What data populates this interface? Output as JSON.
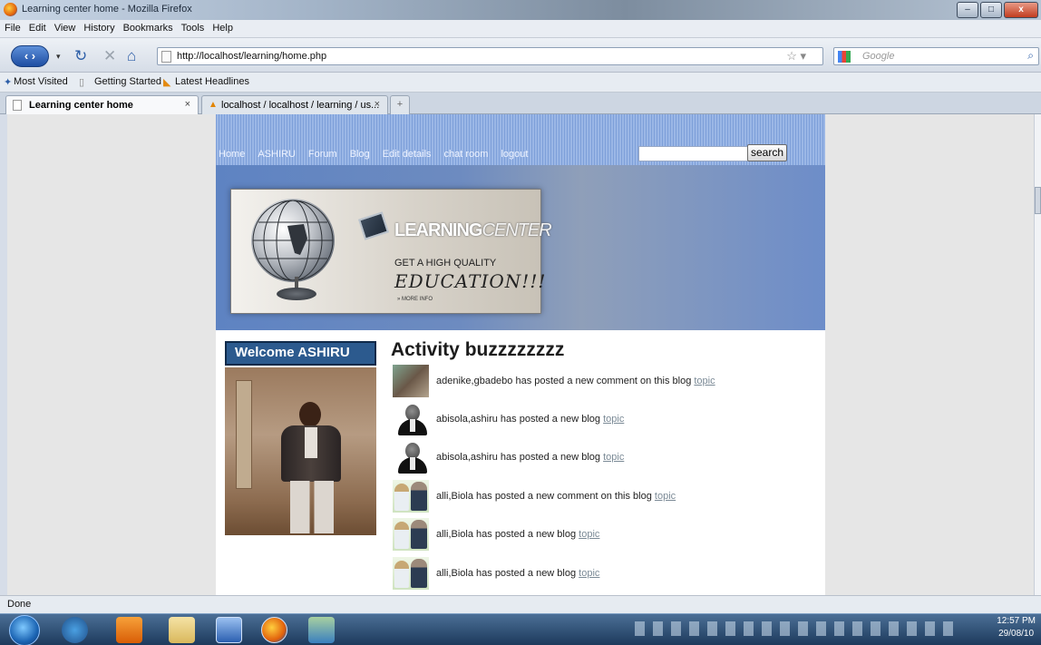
{
  "window": {
    "title": "Learning center home - Mozilla Firefox",
    "minimize": "–",
    "maximize": "□",
    "close": "x"
  },
  "menu": [
    "File",
    "Edit",
    "View",
    "History",
    "Bookmarks",
    "Tools",
    "Help"
  ],
  "nav": {
    "url": "http://localhost/learning/home.php",
    "search_engine_placeholder": "Google"
  },
  "bookmarks": [
    "Most Visited",
    "Getting Started",
    "Latest Headlines"
  ],
  "tabs": [
    {
      "label": "Learning center home",
      "active": true
    },
    {
      "label": "localhost / localhost / learning / us...",
      "active": false
    }
  ],
  "site": {
    "nav_links": [
      "Home",
      "ASHIRU",
      "Forum",
      "Blog",
      "Edit details",
      "chat room",
      "logout"
    ],
    "search_button": "search",
    "banner": {
      "brand": "LEARNING",
      "brand_script": "CENTER",
      "tagline": "GET A HIGH QUALITY",
      "tagline2": "EDUCATION!!!",
      "more": "» MORE INFO"
    },
    "welcome": "Welcome    ASHIRU",
    "activity_title": "Activity buzzzzzzzz",
    "activity": [
      {
        "text": "adenike,gbadebo has posted a new comment on this blog",
        "link": "topic",
        "avatar": "photo"
      },
      {
        "text": "abisola,ashiru has posted a new blog",
        "link": "topic",
        "avatar": "person"
      },
      {
        "text": "abisola,ashiru has posted a new blog",
        "link": "topic",
        "avatar": "person"
      },
      {
        "text": "alli,Biola has posted a new comment on this blog",
        "link": "topic",
        "avatar": "couple"
      },
      {
        "text": "alli,Biola has posted a new blog",
        "link": "topic",
        "avatar": "couple"
      },
      {
        "text": "alli,Biola has posted a new blog",
        "link": "topic",
        "avatar": "couple"
      }
    ]
  },
  "status": "Done",
  "clock": {
    "time": "12:57 PM",
    "date": "29/08/10"
  },
  "colors": {
    "site_blue": "#5e83c2",
    "welcome_bg": "#2c5a8e",
    "link": "#7b8a96"
  }
}
